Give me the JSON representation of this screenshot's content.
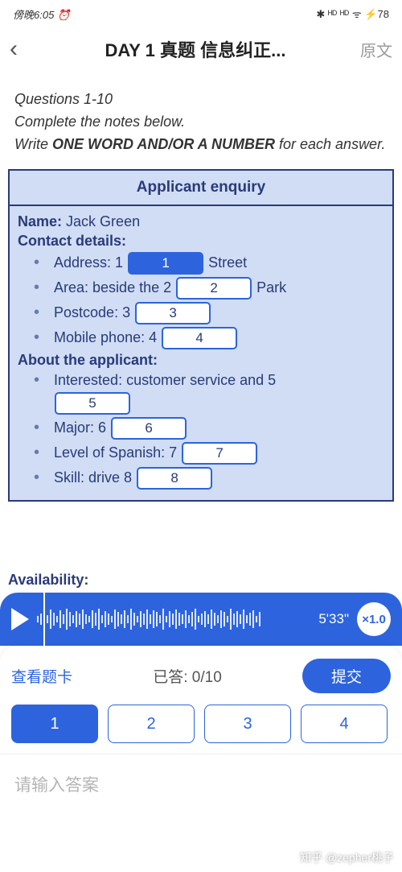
{
  "status": {
    "time_label": "傍晚6:05",
    "alarm_icon": "⏰",
    "icons": "✱ ᴴᴰ ᴴᴰ ᯤ ⚡78"
  },
  "header": {
    "back": "‹",
    "title": "DAY 1 真题 信息纠正...",
    "original": "原文"
  },
  "instructions": {
    "line1": "Questions 1-10",
    "line2": "Complete the notes below.",
    "line3_pre": "Write ",
    "line3_bold": "ONE WORD AND/OR A NUMBER",
    "line3_post": " for each answer."
  },
  "form": {
    "title": "Applicant enquiry",
    "name_label": "Name:",
    "name_value": "Jack Green",
    "contact_label": "Contact details:",
    "address_label": "Address: 1",
    "address_after": "Street",
    "area_label": "Area: beside the 2",
    "area_after": "Park",
    "postcode_label": "Postcode: 3",
    "mobile_label": "Mobile phone: 4",
    "about_label": "About the applicant:",
    "interested_label": "Interested: customer service and 5",
    "major_label": "Major: 6",
    "spanish_label": "Level of Spanish: 7",
    "skill_label": "Skill: drive 8",
    "availability_label": "Availability:",
    "blanks": {
      "b1": "1",
      "b2": "2",
      "b3": "3",
      "b4": "4",
      "b5": "5",
      "b6": "6",
      "b7": "7",
      "b8": "8"
    }
  },
  "player": {
    "time": "5'33\"",
    "speed": "×1.0"
  },
  "controls": {
    "view_card": "查看题卡",
    "answered_label": "已答: 0/10",
    "submit": "提交",
    "q1": "1",
    "q2": "2",
    "q3": "3",
    "q4": "4"
  },
  "answer_placeholder": "请输入答案",
  "watermark": "知乎 @zepher桃子"
}
